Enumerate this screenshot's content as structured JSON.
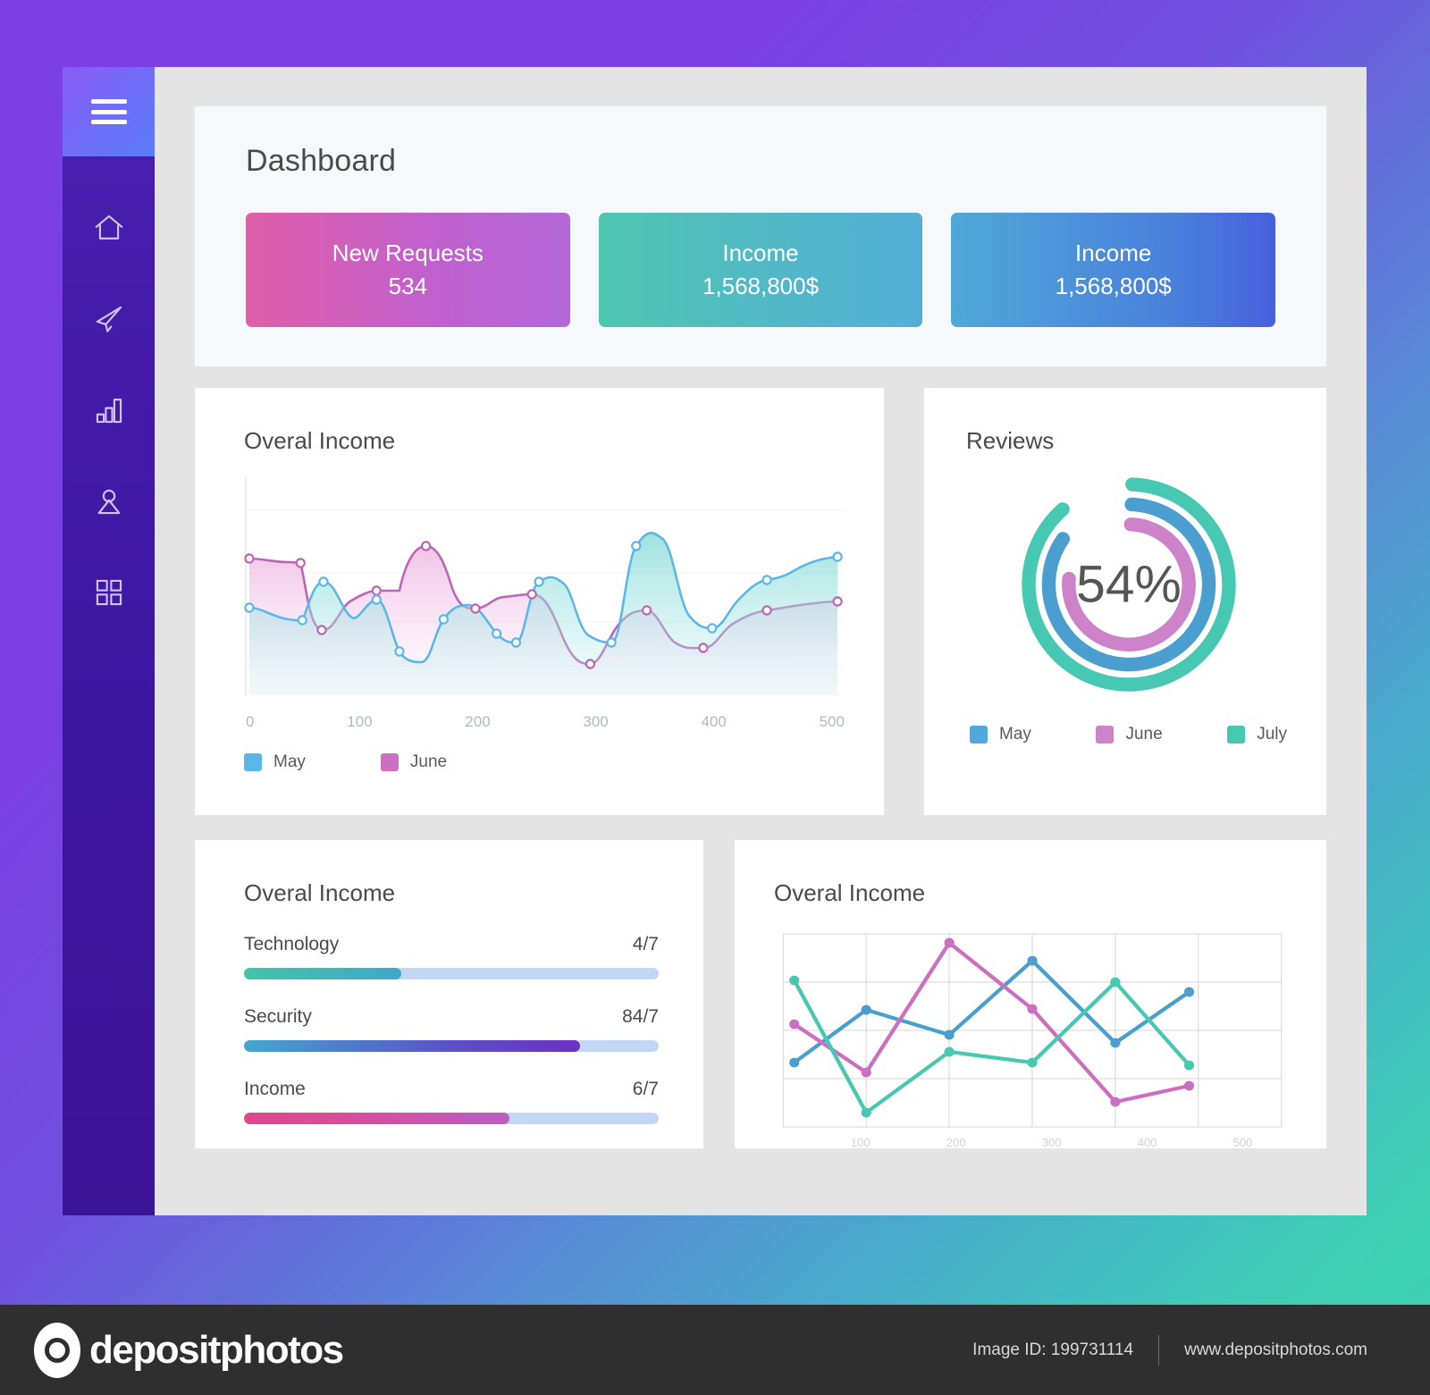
{
  "app": {
    "title": "Dashboard"
  },
  "sidebar": {
    "menu_icon": "hamburger-menu-icon",
    "items": [
      {
        "icon": "home-icon",
        "label": "Home"
      },
      {
        "icon": "send-icon",
        "label": "Messages"
      },
      {
        "icon": "bar-chart-icon",
        "label": "Statistics"
      },
      {
        "icon": "user-icon",
        "label": "Profile"
      },
      {
        "icon": "grid-icon",
        "label": "Apps"
      }
    ]
  },
  "stat_cards": [
    {
      "label": "New Requests",
      "value": "534",
      "color": "#c060cf"
    },
    {
      "label": "Income",
      "value": "1,568,800$",
      "color": "#52b6cb"
    },
    {
      "label": "Income",
      "value": "1,568,800$",
      "color": "#4a7fdc"
    }
  ],
  "panels": {
    "area": {
      "title": "Overal Income"
    },
    "reviews": {
      "title": "Reviews",
      "center_value": "54%"
    },
    "bars": {
      "title": "Overal Income"
    },
    "lines": {
      "title": "Overal Income"
    }
  },
  "progress": {
    "rows": [
      {
        "name": "Technology",
        "value": "4/7",
        "percent": 38
      },
      {
        "name": "Security",
        "value": "84/7",
        "percent": 81
      },
      {
        "name": "Income",
        "value": "6/7",
        "percent": 64
      }
    ]
  },
  "colors": {
    "may": "#5bb7e8",
    "june": "#cd6fc0",
    "july": "#47c8b2",
    "page_bg_start": "#7c3fe4",
    "page_bg_end": "#3ad2ae",
    "panel_bg": "#ffffff",
    "main_bg": "#e4e4e4"
  },
  "footer": {
    "brand": "depositphotos",
    "image_id": "Image ID: 199731114",
    "site": "www.depositphotos.com"
  },
  "chart_data": [
    {
      "type": "area",
      "title": "Overal Income",
      "xlabel": "",
      "ylabel": "",
      "xlim": [
        0,
        500
      ],
      "ylim": [
        0,
        100
      ],
      "grid": true,
      "legend_position": "bottom-left",
      "xticks": [
        "0",
        "100",
        "200",
        "300",
        "400",
        "500"
      ],
      "x": [
        0,
        37,
        68,
        100,
        130,
        160,
        192,
        230,
        262,
        293,
        325,
        358,
        390,
        425,
        458,
        500
      ],
      "series": [
        {
          "name": "May",
          "color": "#5bb7e8",
          "values": [
            42,
            36,
            33,
            52,
            35,
            14,
            47,
            28,
            60,
            28,
            88,
            84,
            42,
            42,
            62,
            70
          ]
        },
        {
          "name": "June",
          "color": "#cd6fc0",
          "values": [
            64,
            61,
            33,
            33,
            54,
            54,
            76,
            48,
            48,
            50,
            20,
            26,
            44,
            18,
            31,
            50
          ]
        }
      ]
    },
    {
      "type": "pie",
      "subtype": "multi-ring-donut",
      "title": "Reviews",
      "center_label": "54%",
      "legend_position": "bottom",
      "series": [
        {
          "name": "July",
          "color": "#47c8b2",
          "ring": "outer",
          "percent": 88
        },
        {
          "name": "May",
          "color": "#4a9ed0",
          "ring": "middle",
          "percent": 84
        },
        {
          "name": "June",
          "color": "#cd82c9",
          "ring": "inner",
          "percent": 76
        }
      ]
    },
    {
      "type": "bar",
      "subtype": "horizontal-progress",
      "title": "Overal Income",
      "categories": [
        "Technology",
        "Security",
        "Income"
      ],
      "value_labels": [
        "4/7",
        "84/7",
        "6/7"
      ],
      "values": [
        38,
        81,
        64
      ],
      "ylim": [
        0,
        100
      ]
    },
    {
      "type": "line",
      "title": "Overal Income",
      "grid": true,
      "xlim": [
        0,
        500
      ],
      "ylim": [
        0,
        100
      ],
      "xticks": [
        "100",
        "200",
        "300",
        "400",
        "500"
      ],
      "x": [
        0,
        100,
        200,
        300,
        400,
        500
      ],
      "series": [
        {
          "name": "May",
          "color": "#4a9ed0",
          "values": [
            30,
            58,
            45,
            82,
            38,
            63
          ]
        },
        {
          "name": "June",
          "color": "#cd6fc0",
          "values": [
            56,
            25,
            94,
            55,
            11,
            19
          ]
        },
        {
          "name": "July",
          "color": "#47c8b2",
          "values": [
            74,
            6,
            42,
            38,
            78,
            30
          ]
        }
      ]
    }
  ]
}
